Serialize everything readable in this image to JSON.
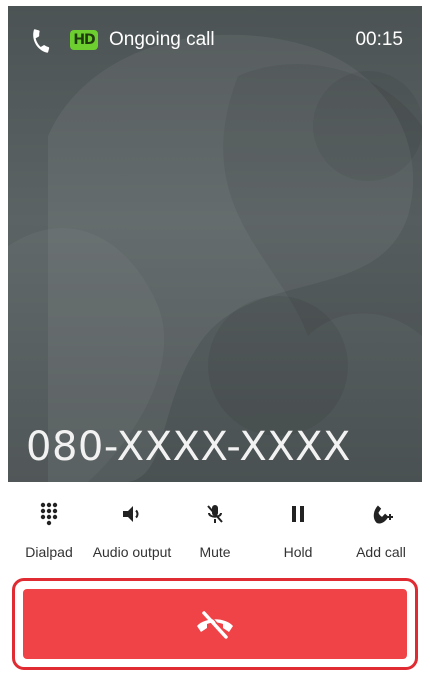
{
  "status_bar": {
    "call_icon": "phone-handset-icon",
    "hd_label": "HD",
    "status_text": "Ongoing call",
    "timer": "00:15"
  },
  "caller": {
    "number": "080-XXXX-XXXX"
  },
  "controls": [
    {
      "label": "Dialpad",
      "icon": "dialpad-icon"
    },
    {
      "label": "Audio output",
      "icon": "speaker-icon"
    },
    {
      "label": "Mute",
      "icon": "mic-off-icon"
    },
    {
      "label": "Hold",
      "icon": "pause-icon"
    },
    {
      "label": "Add call",
      "icon": "add-call-icon"
    }
  ],
  "end_call": {
    "icon": "end-call-icon",
    "color": "#f04348",
    "highlight_color": "#e02b33"
  },
  "colors": {
    "hd_badge": "#6ccf2f",
    "call_background": "#555c5d"
  }
}
